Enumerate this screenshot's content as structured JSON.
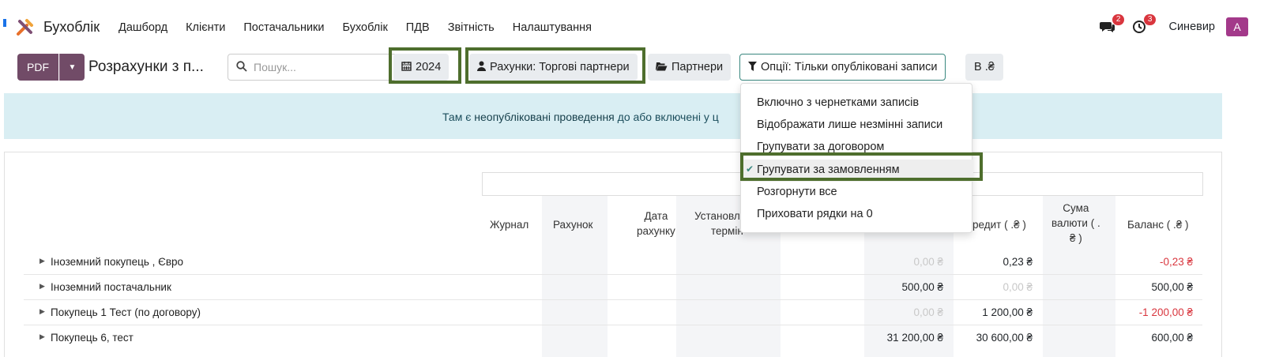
{
  "navbar": {
    "app_title": "Бухоблік",
    "menu": [
      "Дашборд",
      "Клієнти",
      "Постачальники",
      "Бухоблік",
      "ПДВ",
      "Звітність",
      "Налаштування"
    ],
    "messages_badge": "2",
    "activity_badge": "3",
    "company": "Синевир",
    "avatar_letter": "A"
  },
  "control_panel": {
    "pdf_label": "PDF",
    "report_title": "Розрахунки з п...",
    "search_placeholder": "Пошук...",
    "filter_date": "2024",
    "filter_accounts": "Рахунки: Торгові партнери",
    "filter_partners": "Партнери",
    "filter_options": "Опції: Тільки опубліковані записи",
    "currency_button": "В .₴"
  },
  "alert": {
    "prefix": "Там є ",
    "link": "неопубліковані проведення",
    "suffix": " до або включені у ц"
  },
  "options_dropdown": {
    "items": [
      "Включно з чернетками записів",
      "Відображати лише незмінні записи",
      "Групувати за договором",
      "Групувати за замовленням",
      "Розгорнути все",
      "Приховати рядки на 0"
    ],
    "selected": "Групувати за замовленням"
  },
  "table": {
    "columns": {
      "journal": "Журнал",
      "account": "Рахунок",
      "invoice_date_1": "Дата",
      "invoice_date_2": "рахунку",
      "due_1": "Установл",
      "due_2": "термін",
      "credit": "редит ( .₴ )",
      "amount_currency_1": "Сума",
      "amount_currency_2": "валюти ( .",
      "amount_currency_3": "₴ )",
      "balance": "Баланс ( .₴ )"
    },
    "rows": [
      {
        "name": "Іноземний покупець , Євро",
        "debit": "0,00 ₴",
        "credit": "0,23 ₴",
        "balance": "-0,23 ₴"
      },
      {
        "name": "Іноземний постачальник",
        "debit": "500,00 ₴",
        "credit": "0,00 ₴",
        "balance": "500,00 ₴"
      },
      {
        "name": "Покупець 1 Тест (по договору)",
        "debit": "0,00 ₴",
        "credit": "1 200,00 ₴",
        "balance": "-1 200,00 ₴"
      },
      {
        "name": "Покупець 6, тест",
        "debit": "31 200,00 ₴",
        "credit": "30 600,00 ₴",
        "balance": "600,00 ₴"
      }
    ]
  },
  "colors": {
    "brand": "#714b67",
    "highlight_border": "#4e6e2d",
    "negative": "#d9363e",
    "alert_bg": "#d9eef3"
  }
}
